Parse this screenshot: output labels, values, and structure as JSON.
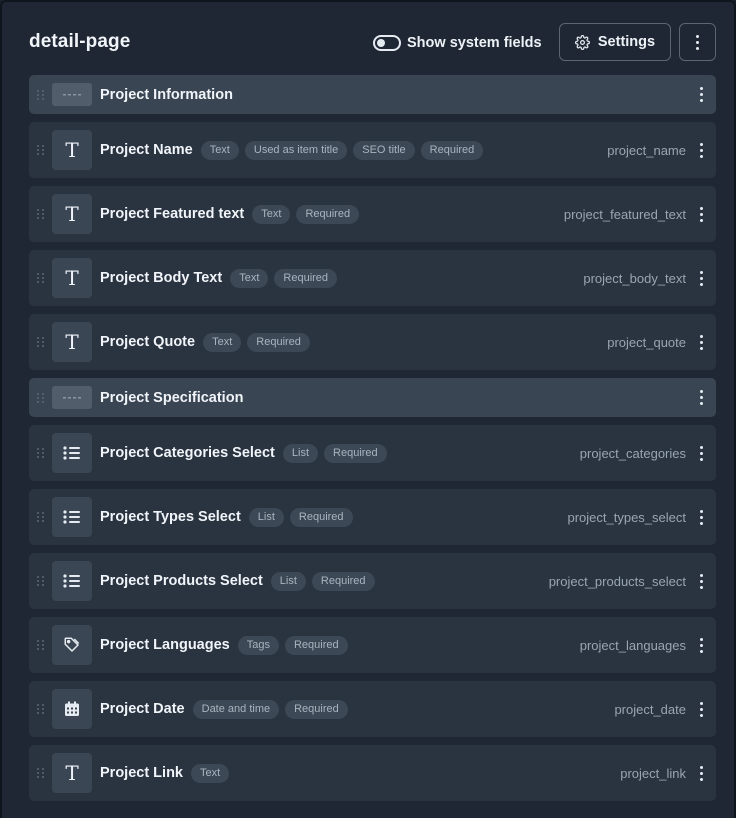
{
  "header": {
    "title": "detail-page",
    "system_toggle_label": "Show system fields",
    "settings_label": "Settings"
  },
  "rows": [
    {
      "kind": "section",
      "name": "Project Information"
    },
    {
      "kind": "field",
      "icon": "text-icon",
      "name": "Project Name",
      "badges": [
        "Text",
        "Used as item title",
        "SEO title",
        "Required"
      ],
      "api": "project_name"
    },
    {
      "kind": "field",
      "icon": "text-icon",
      "name": "Project Featured text",
      "badges": [
        "Text",
        "Required"
      ],
      "api": "project_featured_text"
    },
    {
      "kind": "field",
      "icon": "text-icon",
      "name": "Project Body Text",
      "badges": [
        "Text",
        "Required"
      ],
      "api": "project_body_text"
    },
    {
      "kind": "field",
      "icon": "text-icon",
      "name": "Project Quote",
      "badges": [
        "Text",
        "Required"
      ],
      "api": "project_quote"
    },
    {
      "kind": "section",
      "name": "Project Specification"
    },
    {
      "kind": "field",
      "icon": "list-icon",
      "name": "Project Categories Select",
      "badges": [
        "List",
        "Required"
      ],
      "api": "project_categories"
    },
    {
      "kind": "field",
      "icon": "list-icon",
      "name": "Project Types Select",
      "badges": [
        "List",
        "Required"
      ],
      "api": "project_types_select"
    },
    {
      "kind": "field",
      "icon": "list-icon",
      "name": "Project Products Select",
      "badges": [
        "List",
        "Required"
      ],
      "api": "project_products_select"
    },
    {
      "kind": "field",
      "icon": "tag-icon",
      "name": "Project Languages",
      "badges": [
        "Tags",
        "Required"
      ],
      "api": "project_languages"
    },
    {
      "kind": "field",
      "icon": "calendar-icon",
      "name": "Project Date",
      "badges": [
        "Date and time",
        "Required"
      ],
      "api": "project_date"
    },
    {
      "kind": "field",
      "icon": "text-icon",
      "name": "Project Link",
      "badges": [
        "Text"
      ],
      "api": "project_link"
    }
  ]
}
